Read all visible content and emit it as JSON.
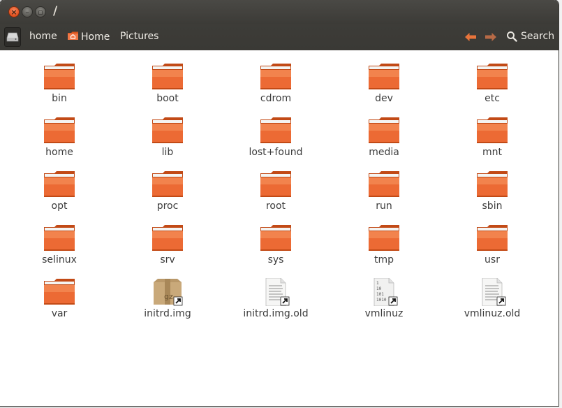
{
  "window": {
    "title": "/"
  },
  "toolbar": {
    "breadcrumbs": [
      {
        "label": "home",
        "icon": ""
      },
      {
        "label": "Home",
        "icon": "home-folder-icon"
      },
      {
        "label": "Pictures",
        "icon": ""
      }
    ],
    "search_label": "Search"
  },
  "files": [
    {
      "name": "bin",
      "type": "folder"
    },
    {
      "name": "boot",
      "type": "folder"
    },
    {
      "name": "cdrom",
      "type": "folder"
    },
    {
      "name": "dev",
      "type": "folder"
    },
    {
      "name": "etc",
      "type": "folder"
    },
    {
      "name": "home",
      "type": "folder"
    },
    {
      "name": "lib",
      "type": "folder"
    },
    {
      "name": "lost+found",
      "type": "folder"
    },
    {
      "name": "media",
      "type": "folder"
    },
    {
      "name": "mnt",
      "type": "folder"
    },
    {
      "name": "opt",
      "type": "folder"
    },
    {
      "name": "proc",
      "type": "folder"
    },
    {
      "name": "root",
      "type": "folder"
    },
    {
      "name": "run",
      "type": "folder"
    },
    {
      "name": "sbin",
      "type": "folder"
    },
    {
      "name": "selinux",
      "type": "folder"
    },
    {
      "name": "srv",
      "type": "folder"
    },
    {
      "name": "sys",
      "type": "folder"
    },
    {
      "name": "tmp",
      "type": "folder"
    },
    {
      "name": "usr",
      "type": "folder"
    },
    {
      "name": "var",
      "type": "folder"
    },
    {
      "name": "initrd.img",
      "type": "archive-link"
    },
    {
      "name": "initrd.img.old",
      "type": "text-link"
    },
    {
      "name": "vmlinuz",
      "type": "binary-link"
    },
    {
      "name": "vmlinuz.old",
      "type": "text-link"
    }
  ],
  "colors": {
    "folder": "#e95420",
    "titlebar": "#3c3b37",
    "accent_arrow": "#e8743b"
  }
}
